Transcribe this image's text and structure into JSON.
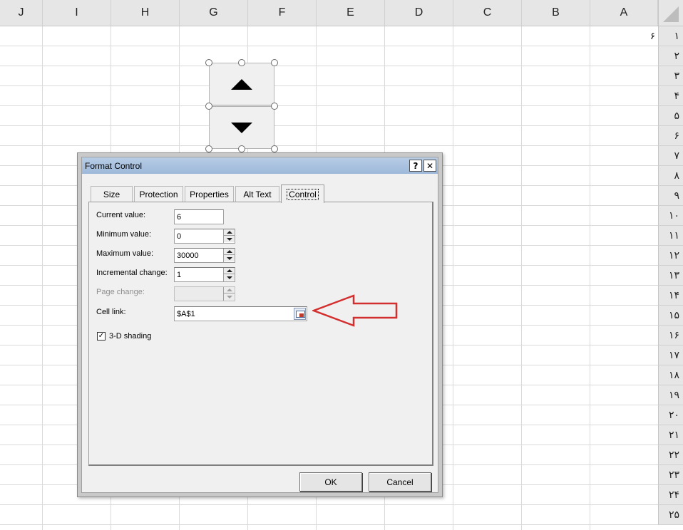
{
  "columns": [
    "J",
    "I",
    "H",
    "G",
    "F",
    "E",
    "D",
    "C",
    "B",
    "A"
  ],
  "rows": [
    "١",
    "٢",
    "٣",
    "۴",
    "۵",
    "۶",
    "٧",
    "٨",
    "٩",
    "١٠",
    "١١",
    "١٢",
    "١٣",
    "١۴",
    "١۵",
    "١۶",
    "١٧",
    "١٨",
    "١٩",
    "٢٠",
    "٢١",
    "٢٢",
    "٢٣",
    "٢۴",
    "٢۵"
  ],
  "cells": {
    "A1": "۶"
  },
  "dialog": {
    "title": "Format Control",
    "help_label": "?",
    "close_label": "✕",
    "tabs": [
      "Size",
      "Protection",
      "Properties",
      "Alt Text",
      "Control"
    ],
    "active_tab": "Control",
    "fields": {
      "current_value": {
        "label": "Current value:",
        "value": "6"
      },
      "minimum_value": {
        "label": "Minimum value:",
        "value": "0"
      },
      "maximum_value": {
        "label": "Maximum value:",
        "value": "30000"
      },
      "incremental_change": {
        "label": "Incremental change:",
        "value": "1"
      },
      "page_change": {
        "label": "Page change:",
        "value": ""
      },
      "cell_link": {
        "label": "Cell link:",
        "value": "$A$1"
      }
    },
    "shading": {
      "label": "3-D shading",
      "checked": true,
      "mark": "✓"
    },
    "ok_label": "OK",
    "cancel_label": "Cancel"
  },
  "colors": {
    "arrow": "#d32f2f",
    "titlebar": "#b8cde6"
  }
}
